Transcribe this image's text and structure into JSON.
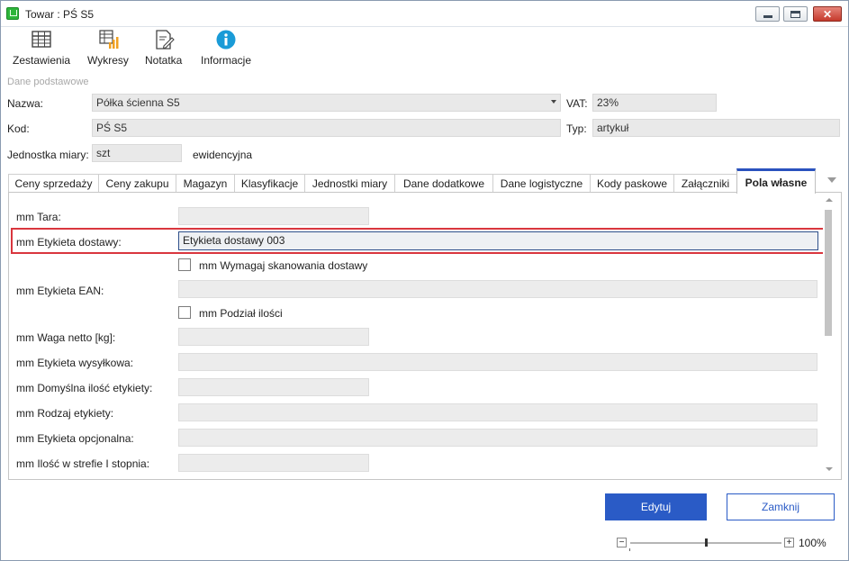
{
  "window": {
    "title": "Towar : PŚ S5"
  },
  "toolbar": {
    "items": [
      {
        "label": "Zestawienia",
        "icon": "table-grid-icon"
      },
      {
        "label": "Wykresy",
        "icon": "chart-icon"
      },
      {
        "label": "Notatka",
        "icon": "note-edit-icon"
      },
      {
        "label": "Informacje",
        "icon": "info-icon"
      }
    ]
  },
  "basic": {
    "section_title": "Dane podstawowe",
    "name_label": "Nazwa:",
    "name_value": "Półka ścienna S5",
    "vat_label": "VAT:",
    "vat_value": "23%",
    "code_label": "Kod:",
    "code_value": "PŚ S5",
    "type_label": "Typ:",
    "type_value": "artykuł",
    "unit_label": "Jednostka miary:",
    "unit_value": "szt",
    "unit_suffix": "ewidencyjna"
  },
  "tabs": [
    "Ceny sprzedaży",
    "Ceny zakupu",
    "Magazyn",
    "Klasyfikacje",
    "Jednostki miary",
    "Dane dodatkowe",
    "Dane logistyczne",
    "Kody paskowe",
    "Załączniki",
    "Pola własne"
  ],
  "active_tab": "Pola własne",
  "custom_fields": {
    "tara_label": "mm Tara:",
    "etykieta_dostawy_label": "mm Etykieta dostawy:",
    "etykieta_dostawy_value": "Etykieta dostawy 003",
    "wymagaj_label": "mm Wymagaj skanowania dostawy",
    "ean_label": "mm Etykieta EAN:",
    "podzial_label": "mm Podział ilości",
    "waga_label": "mm Waga netto [kg]:",
    "wysylkowa_label": "mm Etykieta wysyłkowa:",
    "domyslna_label": "mm Domyślna ilość etykiety:",
    "rodzaj_label": "mm Rodzaj etykiety:",
    "opcjonalna_label": "mm Etykieta opcjonalna:",
    "strefa_label": "mm Ilość w strefie I stopnia:"
  },
  "buttons": {
    "edit": "Edytuj",
    "close": "Zamknij"
  },
  "zoom": {
    "minus": "−",
    "plus": "+",
    "percent": "100%",
    "level": 0.5
  },
  "colors": {
    "accent": "#2a5bc6",
    "highlight_border": "#d9363e",
    "tab_active": "#2a52be"
  }
}
